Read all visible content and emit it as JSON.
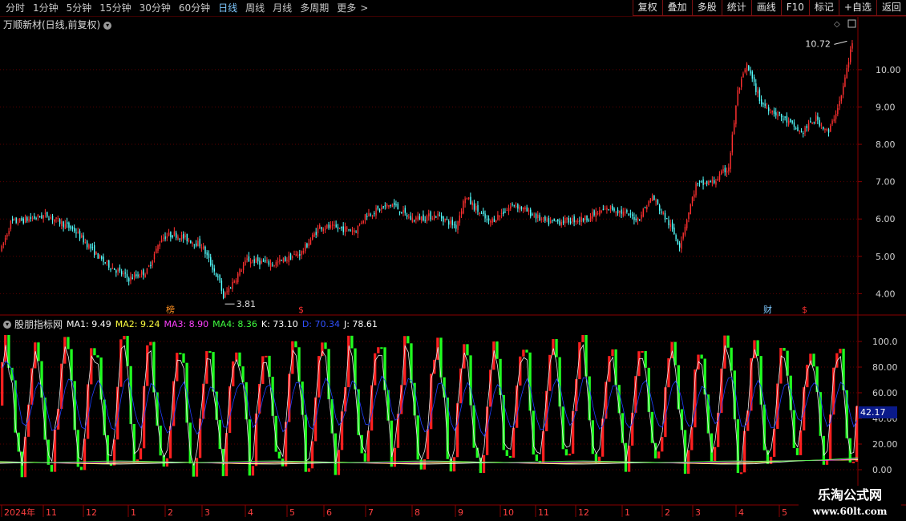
{
  "toolbar": {
    "periods": [
      "分时",
      "1分钟",
      "5分钟",
      "15分钟",
      "30分钟",
      "60分钟",
      "日线",
      "周线",
      "月线",
      "多周期",
      "更多"
    ],
    "active_period": "日线",
    "more_arrow": ">",
    "buttons": [
      "复权",
      "叠加",
      "多股",
      "统计",
      "画线",
      "F10",
      "标记",
      "+自选",
      "返回"
    ]
  },
  "price_panel": {
    "title": "万顺新材(日线,前复权)",
    "high_label": "10.72",
    "low_label": "3.81",
    "y_ticks": [
      "10.00",
      "9.00",
      "8.00",
      "7.00",
      "6.00",
      "5.00",
      "4.00"
    ],
    "markers": [
      "榜",
      "$",
      "财",
      "$"
    ]
  },
  "indicator": {
    "name": "股朋指标网",
    "items": [
      {
        "label": "MA1: 9.49",
        "color": "#ffffff"
      },
      {
        "label": "MA2: 9.24",
        "color": "#ffff40"
      },
      {
        "label": "MA3: 8.90",
        "color": "#ff40ff"
      },
      {
        "label": "MA4: 8.36",
        "color": "#40ff40"
      },
      {
        "label": "K: 73.10",
        "color": "#ffffff"
      },
      {
        "label": "D: 70.34",
        "color": "#3050ff"
      },
      {
        "label": "J: 78.61",
        "color": "#ffffff"
      }
    ],
    "y_ticks": [
      "100.0",
      "80.00",
      "60.00",
      "40.00",
      "20.00",
      "0.00"
    ],
    "cursor_value": "42.17"
  },
  "time_axis": {
    "labels": [
      "2024年",
      "11",
      "12",
      "1",
      "2",
      "3",
      "4",
      "5",
      "6",
      "7",
      "8",
      "9",
      "10",
      "11",
      "12",
      "1",
      "2",
      "3",
      "4",
      "5"
    ]
  },
  "watermark": {
    "title": "乐淘公式网",
    "url": "www.60lt.com"
  },
  "colors": {
    "up": "#ff3030",
    "down": "#54ffff",
    "grid": "#5a0000",
    "kdj_up": "#ff2020",
    "kdj_down": "#20ff20"
  }
}
